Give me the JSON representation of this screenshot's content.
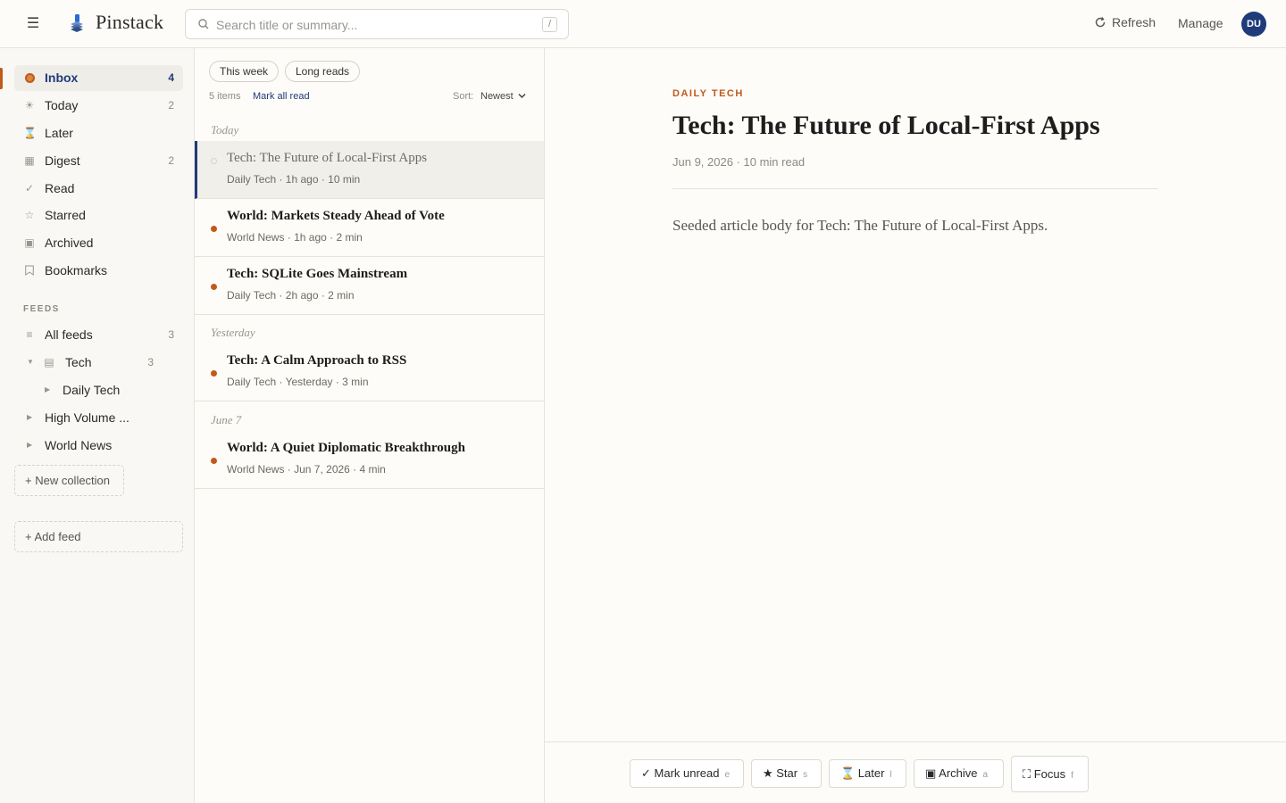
{
  "header": {
    "app_name": "Pinstack",
    "search_placeholder": "Search title or summary...",
    "search_shortcut": "/",
    "refresh_label": "Refresh",
    "manage_label": "Manage",
    "avatar_initials": "DU"
  },
  "sidebar": {
    "nav": [
      {
        "label": "Inbox",
        "count": "4",
        "icon": "inbox-dot-icon"
      },
      {
        "label": "Today",
        "count": "2",
        "icon": "sun-icon"
      },
      {
        "label": "Later",
        "count": "",
        "icon": "hourglass-icon"
      },
      {
        "label": "Digest",
        "count": "2",
        "icon": "digest-icon"
      },
      {
        "label": "Read",
        "count": "",
        "icon": "check-icon"
      },
      {
        "label": "Starred",
        "count": "",
        "icon": "star-icon"
      },
      {
        "label": "Archived",
        "count": "",
        "icon": "archive-icon"
      },
      {
        "label": "Bookmarks",
        "count": "",
        "icon": "bookmark-icon"
      }
    ],
    "feeds_title": "FEEDS",
    "feeds": [
      {
        "label": "All feeds",
        "count": "3"
      },
      {
        "label": "Tech",
        "count": "3"
      },
      {
        "label": "Daily Tech",
        "count": ""
      },
      {
        "label": "High Volume ...",
        "count": ""
      },
      {
        "label": "World News",
        "count": ""
      }
    ],
    "new_collection_label": "+ New collection",
    "add_feed_label": "+ Add feed"
  },
  "list": {
    "chips": [
      "This week",
      "Long reads"
    ],
    "items_count": "5 items",
    "mark_all_read": "Mark all read",
    "sort_label": "Sort:",
    "sort_value": "Newest",
    "groups": [
      {
        "label": "Today"
      },
      {
        "label": "Yesterday"
      },
      {
        "label": "June 7"
      }
    ],
    "rows": [
      {
        "title": "Tech: The Future of Local-First Apps",
        "meta": "Daily Tech · 1h ago · 10 min"
      },
      {
        "title": "World: Markets Steady Ahead of Vote",
        "meta": "World News · 1h ago · 2 min"
      },
      {
        "title": "Tech: SQLite Goes Mainstream",
        "meta": "Daily Tech · 2h ago · 2 min"
      },
      {
        "title": "Tech: A Calm Approach to RSS",
        "meta": "Daily Tech · Yesterday · 3 min"
      },
      {
        "title": "World: A Quiet Diplomatic Breakthrough",
        "meta": "World News · Jun 7, 2026 · 4 min"
      }
    ]
  },
  "reader": {
    "kicker": "DAILY TECH",
    "title": "Tech: The Future of Local-First Apps",
    "meta": "Jun 9, 2026 · 10 min read",
    "body": "Seeded article body for Tech: The Future of Local-First Apps."
  },
  "actions": [
    {
      "label": "✓ Mark unread",
      "key": "e"
    },
    {
      "label": "★ Star",
      "key": "s"
    },
    {
      "label": "⌛ Later",
      "key": "l"
    },
    {
      "label": "▣ Archive",
      "key": "a"
    },
    {
      "label": "⛶ Focus",
      "key": "f"
    }
  ],
  "colors": {
    "accent": "#c05a1a",
    "link": "#1f3b7a",
    "background": "#fdfcf8"
  }
}
